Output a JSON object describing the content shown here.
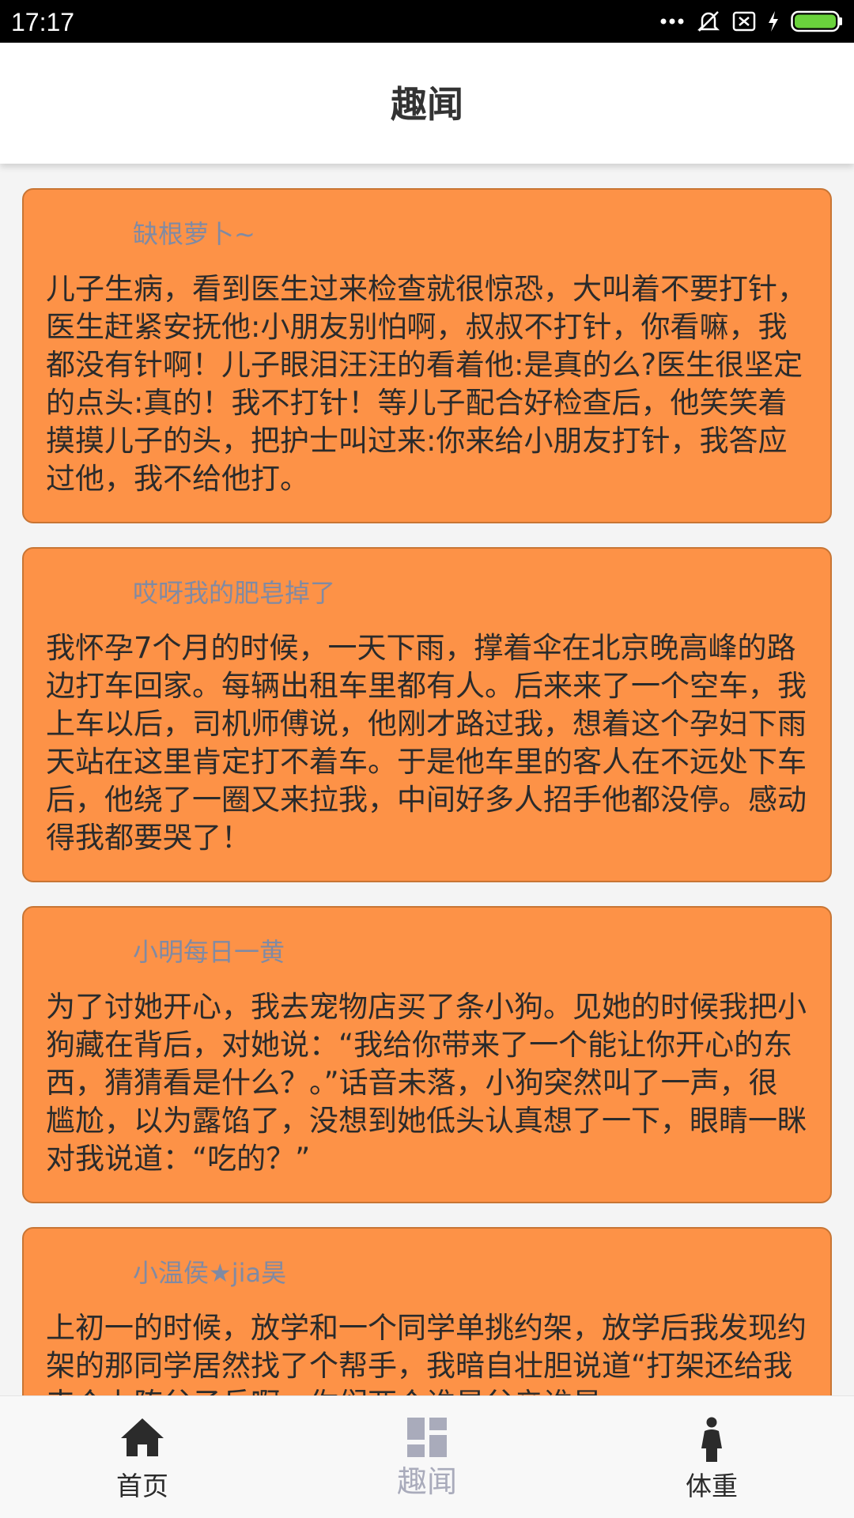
{
  "status_bar": {
    "time": "17:17",
    "icons": [
      "more-dots-icon",
      "vibrate-off-icon",
      "sim-blocked-icon",
      "charging-icon",
      "battery-icon"
    ]
  },
  "header": {
    "title": "趣闻"
  },
  "feed": {
    "posts": [
      {
        "author": "缺根萝卜~",
        "content": "儿子生病，看到医生过来检查就很惊恐，大叫着不要打针，医生赶紧安抚他:小朋友别怕啊，叔叔不打针，你看嘛，我都没有针啊！儿子眼泪汪汪的看着他:是真的么?医生很坚定的点头:真的！我不打针！等儿子配合好检查后，他笑笑着摸摸儿子的头，把护士叫过来:你来给小朋友打针，我答应过他，我不给他打。"
      },
      {
        "author": "哎呀我的肥皂掉了",
        "content": "我怀孕7个月的时候，一天下雨，撑着伞在北京晚高峰的路边打车回家。每辆出租车里都有人。后来来了一个空车，我上车以后，司机师傅说，他刚才路过我，想着这个孕妇下雨天站在这里肯定打不着车。于是他车里的客人在不远处下车后，他绕了一圈又来拉我，中间好多人招手他都没停。感动得我都要哭了！"
      },
      {
        "author": "小明每日一黄",
        "content": "为了讨她开心，我去宠物店买了条小狗。见她的时候我把小狗藏在背后，对她说：“我给你带来了一个能让你开心的东西，猜猜看是什么？。”话音未落，小狗突然叫了一声，很尴尬，以为露馅了，没想到她低头认真想了一下，眼睛一眯对我说道：“吃的？”"
      },
      {
        "author": "小温侯★jia昊",
        "content": "上初一的时候，放学和一个同学单挑约架，放学后我发现约架的那同学居然找了个帮手，我暗自壮胆说道“打架还给我来个上阵父子兵啊，你们两个谁是父亲谁是"
      }
    ]
  },
  "tabs": [
    {
      "label": "首页",
      "icon": "home-icon",
      "active": false
    },
    {
      "label": "趣闻",
      "icon": "dashboard-icon",
      "active": true
    },
    {
      "label": "体重",
      "icon": "person-icon",
      "active": false
    }
  ],
  "colors": {
    "card_bg": "#fd9247",
    "card_border": "#c87534",
    "author_text": "#808aa3",
    "active_tab": "#a9abbb"
  }
}
